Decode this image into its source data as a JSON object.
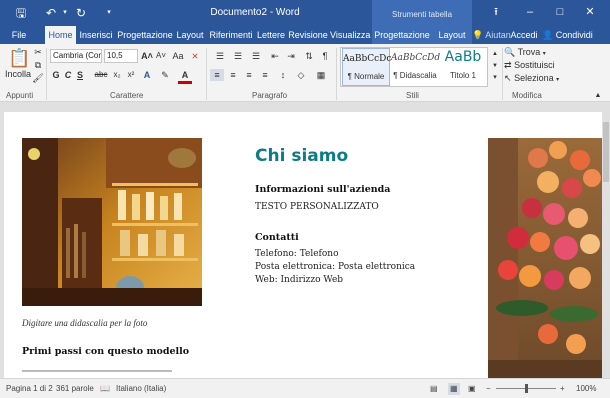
{
  "titlebar": {
    "document_title": "Documento2 - Word",
    "table_tools": "Strumenti tabella"
  },
  "tabs": [
    "File",
    "Home",
    "Inserisci",
    "Progettazione",
    "Layout",
    "Riferimenti",
    "Lettere",
    "Revisione",
    "Visualizza",
    "Progettazione",
    "Layout"
  ],
  "search": {
    "label": "Aiutan"
  },
  "account": {
    "signin": "Accedi",
    "share": "Condividi"
  },
  "ribbon": {
    "paste_label": "Incolla",
    "font_name": "Cambria (Cor",
    "font_size": "10,5",
    "bold": "G",
    "italic": "C",
    "underline": "S",
    "strike": "abc",
    "sub": "x₂",
    "sup": "x²",
    "font_color_letter": "A",
    "styles": [
      {
        "sample": "AaBbCcDc",
        "name": "¶ Normale"
      },
      {
        "sample": "AaBbCcDd",
        "name": "¶ Didascalia"
      },
      {
        "sample": "AaBb",
        "name": "Titolo 1"
      }
    ],
    "find": "Trova",
    "replace": "Sostituisci",
    "select": "Seleziona",
    "groups": {
      "clipboard": "Appunti",
      "font": "Carattere",
      "paragraph": "Paragrafo",
      "styles": "Stili",
      "editing": "Modifica"
    }
  },
  "document": {
    "title": "Chi siamo",
    "about_heading": "Informazioni sull'azienda",
    "about_text": "TESTO PERSONALIZZATO",
    "contacts_heading": "Contatti",
    "phone": "Telefono: Telefono",
    "email": "Posta elettronica: Posta elettronica",
    "web": "Web: Indirizzo Web",
    "caption": "Digitare una didascalia per la foto",
    "side_heading": "Primi passi con questo modello"
  },
  "status": {
    "page": "Pagina 1 di 2",
    "words": "361 parole",
    "language": "Italiano (Italia)",
    "zoom_level": "100%",
    "zoom_fraction": 0.5
  },
  "colors": {
    "accent": "#2b579a",
    "title_teal": "#0e7c86"
  }
}
